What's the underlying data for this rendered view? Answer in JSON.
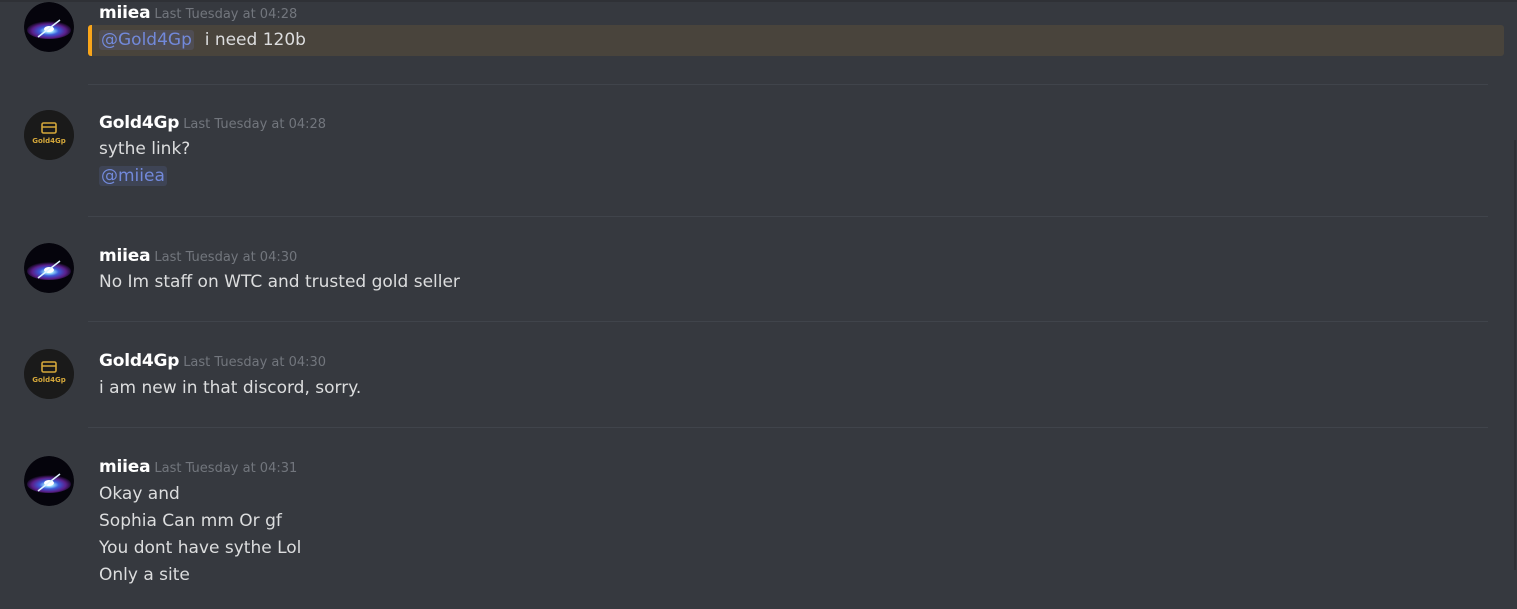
{
  "colors": {
    "background": "#36393f",
    "username": "#ffffff",
    "timestamp": "#72767d",
    "text": "#dcddde",
    "mention": "#7289da",
    "mention_highlight_bg": "#49443c",
    "mention_highlight_bar": "#faa61a"
  },
  "messages": [
    {
      "author": "miiea",
      "avatar_icon": "galaxy-avatar-icon",
      "timestamp": "Last Tuesday at 04:28",
      "mention": "@Gold4Gp",
      "text": "i need 120b",
      "highlighted": true
    },
    {
      "author": "Gold4Gp",
      "avatar_icon": "gold4gp-logo-avatar",
      "avatar_label": "Gold4Gp",
      "timestamp": "Last Tuesday at 04:28",
      "lines": [
        "sythe link?"
      ],
      "mention": "@miiea"
    },
    {
      "author": "miiea",
      "avatar_icon": "galaxy-avatar-icon",
      "timestamp": "Last Tuesday at 04:30",
      "lines": [
        "No Im staff on WTC and trusted gold seller"
      ]
    },
    {
      "author": "Gold4Gp",
      "avatar_icon": "gold4gp-logo-avatar",
      "avatar_label": "Gold4Gp",
      "timestamp": "Last Tuesday at 04:30",
      "lines": [
        "i am new in that discord, sorry."
      ]
    },
    {
      "author": "miiea",
      "avatar_icon": "galaxy-avatar-icon",
      "timestamp": "Last Tuesday at 04:31",
      "lines": [
        "Okay and",
        "Sophia Can mm Or gf",
        "You dont have sythe Lol",
        "Only a site"
      ]
    }
  ]
}
